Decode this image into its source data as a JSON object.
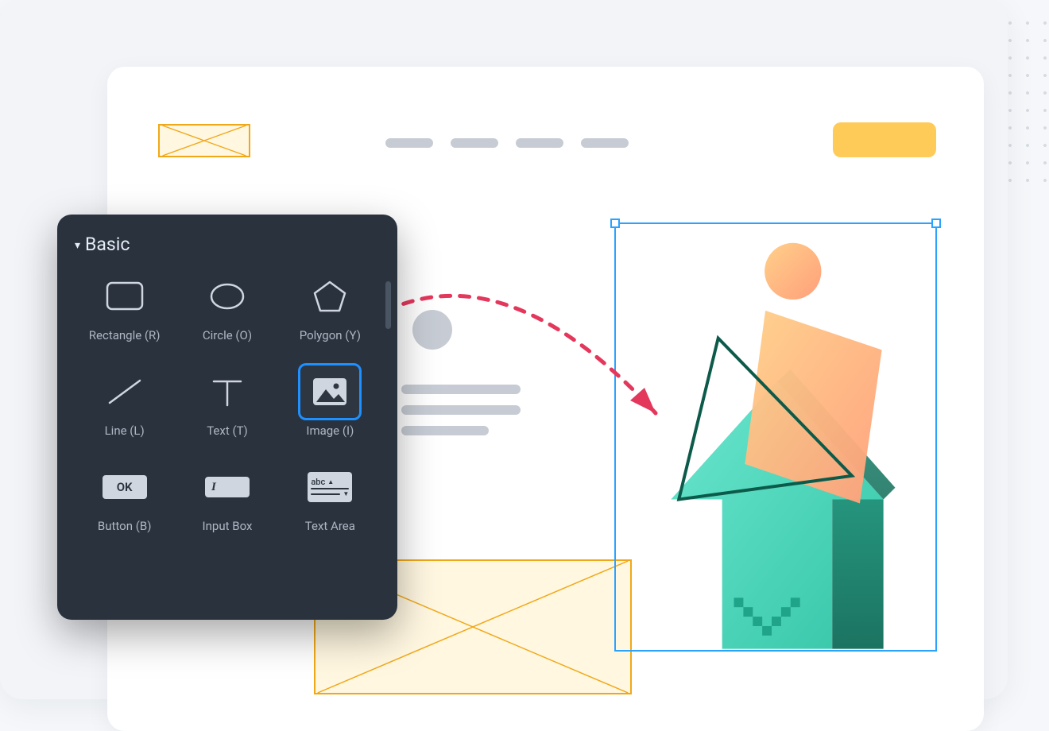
{
  "panel": {
    "title": "Basic",
    "tools": [
      {
        "label": "Rectangle (R)"
      },
      {
        "label": "Circle (O)"
      },
      {
        "label": "Polygon (Y)"
      },
      {
        "label": "Line (L)"
      },
      {
        "label": "Text (T)"
      },
      {
        "label": "Image (I)"
      },
      {
        "label": "Button (B)"
      },
      {
        "label": "Input Box"
      },
      {
        "label": "Text Area"
      }
    ],
    "ok_glyph": "OK",
    "input_glyph": "I",
    "textarea_glyph": "abc"
  },
  "colors": {
    "accent_blue": "#1e90ff",
    "selection_blue": "#2aa3ff",
    "panel_bg": "#2a323e",
    "placeholder_gray": "#c7ccd4",
    "warm_yellow": "#ffcb58",
    "outline_amber": "#f0a818",
    "drag_red": "#e4375c"
  }
}
